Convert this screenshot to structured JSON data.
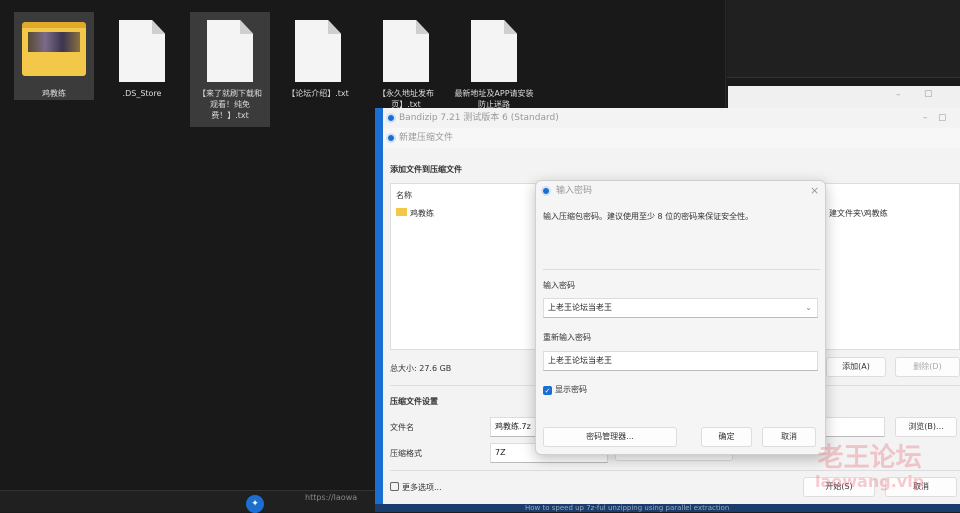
{
  "explorer": {
    "items": [
      {
        "name": "鸡教练",
        "type": "folder"
      },
      {
        "name": ".DS_Store",
        "type": "file"
      },
      {
        "name": "【来了就刷下载和观看！纯免费！】.txt",
        "type": "file",
        "selected": true
      },
      {
        "name": "【论坛介绍】.txt",
        "type": "file"
      },
      {
        "name": "【永久地址发布页】.txt",
        "type": "file"
      },
      {
        "name": "最新地址及APP请安装防止迷路",
        "type": "file"
      }
    ]
  },
  "taskbar": {
    "url": "https://laowa"
  },
  "bandizip": {
    "title": "Bandizip 7.21 测试版本 6 (Standard)"
  },
  "new_archive": {
    "title": "新建压缩文件",
    "add_heading": "添加文件到压缩文件",
    "list_header": "名称",
    "list_item": "鸡教练",
    "path_text": "建文件夹\\鸡教练",
    "total_size": "总大小: 27.6 GB",
    "add_button": "添加(A)",
    "delete_button": "删除(D)",
    "settings_heading": "压缩文件设置",
    "filename_label": "文件名",
    "filename_value": "鸡教练.7z",
    "browse_button": "浏览(B)...",
    "format_label": "压缩格式",
    "format_value": "7Z",
    "more_options": "更多选项...",
    "start_button": "开始(S)",
    "cancel_button": "取消"
  },
  "password_dialog": {
    "title": "输入密码",
    "description": "输入压缩包密码。建议使用至少 8 位的密码来保证安全性。",
    "password_label": "输入密码",
    "password_value": "上老王论坛当老王",
    "reenter_label": "重新输入密码",
    "reenter_value": "上老王论坛当老王",
    "show_password": "显示密码",
    "show_password_checked": true,
    "manager_button": "密码管理器...",
    "ok_button": "确定",
    "cancel_button": "取消"
  },
  "bottom_bar": {
    "text": "How to speed up 7z-ful unzipping using parallel extraction"
  },
  "watermark": {
    "line1": "老王论坛",
    "line2": "laowang.vip"
  },
  "colors": {
    "accent": "#1c6fd0",
    "dark_bg": "#191919"
  }
}
